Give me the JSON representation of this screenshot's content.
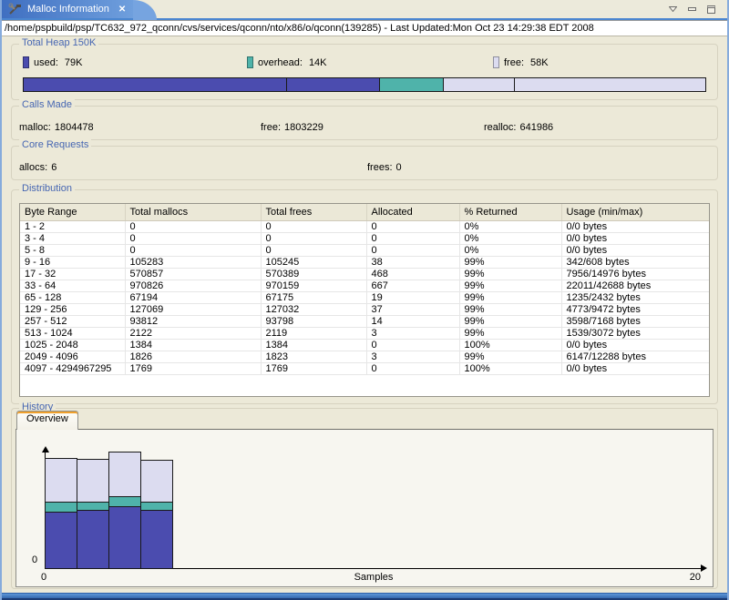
{
  "window": {
    "tab": {
      "title": "Malloc Information"
    },
    "path_bar": "/home/pspbuild/psp/TC632_972_qconn/cvs/services/qconn/nto/x86/o/qconn(139285)  - Last Updated:Mon Oct 23 14:29:38 EDT 2008"
  },
  "colors": {
    "used": "#4b4caf",
    "overhead": "#4fb3aa",
    "free": "#dcdcf0"
  },
  "total_heap": {
    "label": "Total Heap 150K",
    "legend": [
      {
        "label": "used:",
        "value": "79K",
        "color": "#4b4caf"
      },
      {
        "label": "overhead:",
        "value": "14K",
        "color": "#4fb3aa"
      },
      {
        "label": "free:",
        "value": "58K",
        "color": "#dcdcf0"
      }
    ],
    "bar_segments": [
      {
        "name": "used-band-1",
        "color": "#4b4caf",
        "pct": 38.7
      },
      {
        "name": "used-band-2",
        "color": "#4b4caf",
        "pct": 13.6
      },
      {
        "name": "overhead-band",
        "color": "#4fb3aa",
        "pct": 9.3
      },
      {
        "name": "free-band-1",
        "color": "#dcdcf0",
        "pct": 10.4
      },
      {
        "name": "free-band-2",
        "color": "#dcdcf0",
        "pct": 28.0
      }
    ]
  },
  "calls_made": {
    "label": "Calls Made",
    "stats": [
      {
        "label": "malloc:",
        "value": "1804478"
      },
      {
        "label": "free:",
        "value": "1803229"
      },
      {
        "label": "realloc:",
        "value": "641986"
      }
    ]
  },
  "core_requests": {
    "label": "Core Requests",
    "stats": [
      {
        "label": "allocs:",
        "value": "6"
      },
      {
        "label": "frees:",
        "value": "0"
      }
    ]
  },
  "distribution": {
    "label": "Distribution",
    "columns": [
      "Byte Range",
      "Total mallocs",
      "Total frees",
      "Allocated",
      "% Returned",
      "Usage (min/max)"
    ],
    "rows": [
      [
        "1 - 2",
        "0",
        "0",
        "0",
        "0%",
        "0/0 bytes"
      ],
      [
        "3 - 4",
        "0",
        "0",
        "0",
        "0%",
        "0/0 bytes"
      ],
      [
        "5 - 8",
        "0",
        "0",
        "0",
        "0%",
        "0/0 bytes"
      ],
      [
        "9 - 16",
        "105283",
        "105245",
        "38",
        "99%",
        "342/608 bytes"
      ],
      [
        "17 - 32",
        "570857",
        "570389",
        "468",
        "99%",
        "7956/14976 bytes"
      ],
      [
        "33 - 64",
        "970826",
        "970159",
        "667",
        "99%",
        "22011/42688 bytes"
      ],
      [
        "65 - 128",
        "67194",
        "67175",
        "19",
        "99%",
        "1235/2432 bytes"
      ],
      [
        "129 - 256",
        "127069",
        "127032",
        "37",
        "99%",
        "4773/9472 bytes"
      ],
      [
        "257 - 512",
        "93812",
        "93798",
        "14",
        "99%",
        "3598/7168 bytes"
      ],
      [
        "513 - 1024",
        "2122",
        "2119",
        "3",
        "99%",
        "1539/3072 bytes"
      ],
      [
        "1025 - 2048",
        "1384",
        "1384",
        "0",
        "100%",
        "0/0 bytes"
      ],
      [
        "2049 - 4096",
        "1826",
        "1823",
        "3",
        "99%",
        "6147/12288 bytes"
      ],
      [
        "4097 - 4294967295",
        "1769",
        "1769",
        "0",
        "100%",
        "0/0 bytes"
      ]
    ]
  },
  "history": {
    "label": "History",
    "tab": "Overview",
    "chart_data": {
      "type": "bar",
      "stacked": true,
      "x": [
        1,
        2,
        3,
        4
      ],
      "series": [
        {
          "name": "used",
          "color": "#4b4caf",
          "values": [
            77,
            79,
            84,
            79
          ]
        },
        {
          "name": "overhead",
          "color": "#4fb3aa",
          "values": [
            14,
            11,
            14,
            11
          ]
        },
        {
          "name": "free",
          "color": "#dcdcf0",
          "values": [
            59,
            58,
            60,
            57
          ]
        }
      ],
      "units": "K",
      "xlabel": "Samples",
      "xlim": [
        0,
        20
      ],
      "x_origin_label": "0",
      "x_end_label": "20",
      "y_origin_label": "0",
      "grid": false,
      "legend_position": "none"
    }
  }
}
